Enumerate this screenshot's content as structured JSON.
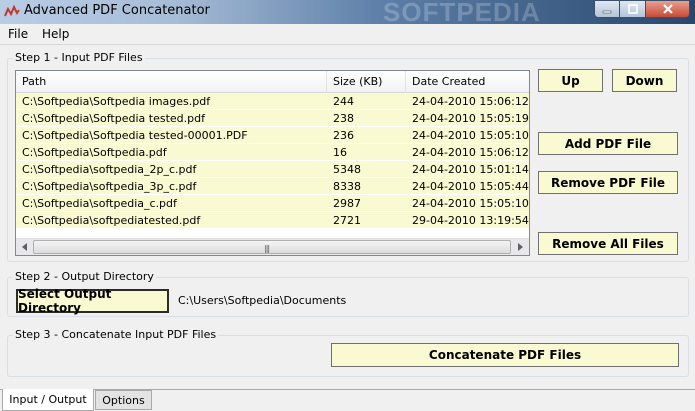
{
  "window": {
    "title": "Advanced PDF Concatenator",
    "watermark": "SOFTPEDIA"
  },
  "menu": {
    "items": [
      {
        "label": "File"
      },
      {
        "label": "Help"
      }
    ]
  },
  "step1": {
    "label": "Step 1 - Input PDF Files",
    "columns": [
      "Path",
      "Size (KB)",
      "Date Created"
    ],
    "rows": [
      {
        "path": "C:\\Softpedia\\Softpedia images.pdf",
        "size": "244",
        "date": "24-04-2010 15:06:12"
      },
      {
        "path": "C:\\Softpedia\\Softpedia tested.pdf",
        "size": "238",
        "date": "24-04-2010 15:05:19"
      },
      {
        "path": "C:\\Softpedia\\Softpedia tested-00001.PDF",
        "size": "236",
        "date": "24-04-2010 15:05:10"
      },
      {
        "path": "C:\\Softpedia\\Softpedia.pdf",
        "size": "16",
        "date": "24-04-2010 15:06:12"
      },
      {
        "path": "C:\\Softpedia\\softpedia_2p_c.pdf",
        "size": "5348",
        "date": "24-04-2010 15:01:14"
      },
      {
        "path": "C:\\Softpedia\\softpedia_3p_c.pdf",
        "size": "8338",
        "date": "24-04-2010 15:05:44"
      },
      {
        "path": "C:\\Softpedia\\softpedia_c.pdf",
        "size": "2987",
        "date": "24-04-2010 15:05:10"
      },
      {
        "path": "C:\\Softpedia\\softpediatested.pdf",
        "size": "2721",
        "date": "29-04-2010 13:19:54"
      }
    ],
    "buttons": {
      "up": "Up",
      "down": "Down",
      "add": "Add PDF File",
      "remove": "Remove PDF File",
      "remove_all": "Remove All Files"
    }
  },
  "step2": {
    "label": "Step 2 - Output Directory",
    "button": "Select Output Directory",
    "path": "C:\\Users\\Softpedia\\Documents"
  },
  "step3": {
    "label": "Step 3 - Concatenate Input PDF Files",
    "button": "Concatenate PDF Files"
  },
  "tabs": [
    {
      "label": "Input / Output"
    },
    {
      "label": "Options"
    }
  ],
  "colors": {
    "button_bg": "#fafad2",
    "row_bg": "#fafad2",
    "titlebar": "#5d7fa8"
  }
}
